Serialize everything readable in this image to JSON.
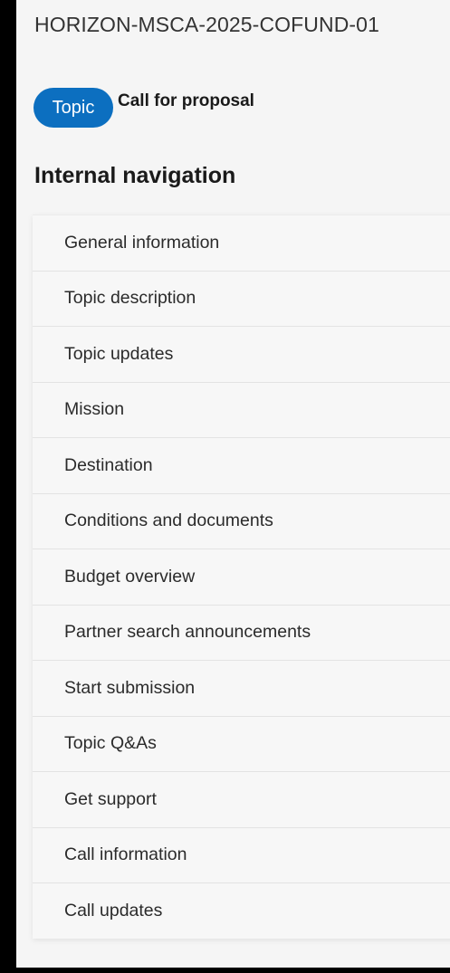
{
  "header": {
    "call_identifier": "HORIZON-MSCA-2025-COFUND-01"
  },
  "badge": {
    "label": "Topic",
    "text": "Call for proposal"
  },
  "navigation": {
    "heading": "Internal navigation",
    "items": [
      {
        "label": "General information"
      },
      {
        "label": "Topic description"
      },
      {
        "label": "Topic updates"
      },
      {
        "label": "Mission"
      },
      {
        "label": "Destination"
      },
      {
        "label": "Conditions and documents"
      },
      {
        "label": "Budget overview"
      },
      {
        "label": "Partner search announcements"
      },
      {
        "label": "Start submission"
      },
      {
        "label": "Topic Q&As"
      },
      {
        "label": "Get support"
      },
      {
        "label": "Call information"
      },
      {
        "label": "Call updates"
      }
    ]
  },
  "colors": {
    "accent": "#0c6fc0",
    "background": "#f5f5f5",
    "frame": "#000000"
  }
}
